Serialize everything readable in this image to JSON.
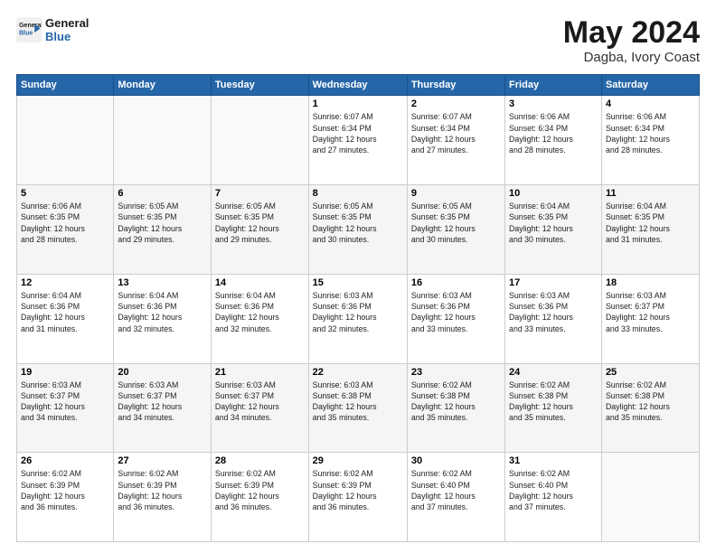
{
  "logo": {
    "line1": "General",
    "line2": "Blue"
  },
  "header": {
    "month_year": "May 2024",
    "location": "Dagba, Ivory Coast"
  },
  "weekdays": [
    "Sunday",
    "Monday",
    "Tuesday",
    "Wednesday",
    "Thursday",
    "Friday",
    "Saturday"
  ],
  "weeks": [
    [
      {
        "day": "",
        "info": ""
      },
      {
        "day": "",
        "info": ""
      },
      {
        "day": "",
        "info": ""
      },
      {
        "day": "1",
        "info": "Sunrise: 6:07 AM\nSunset: 6:34 PM\nDaylight: 12 hours\nand 27 minutes."
      },
      {
        "day": "2",
        "info": "Sunrise: 6:07 AM\nSunset: 6:34 PM\nDaylight: 12 hours\nand 27 minutes."
      },
      {
        "day": "3",
        "info": "Sunrise: 6:06 AM\nSunset: 6:34 PM\nDaylight: 12 hours\nand 28 minutes."
      },
      {
        "day": "4",
        "info": "Sunrise: 6:06 AM\nSunset: 6:34 PM\nDaylight: 12 hours\nand 28 minutes."
      }
    ],
    [
      {
        "day": "5",
        "info": "Sunrise: 6:06 AM\nSunset: 6:35 PM\nDaylight: 12 hours\nand 28 minutes."
      },
      {
        "day": "6",
        "info": "Sunrise: 6:05 AM\nSunset: 6:35 PM\nDaylight: 12 hours\nand 29 minutes."
      },
      {
        "day": "7",
        "info": "Sunrise: 6:05 AM\nSunset: 6:35 PM\nDaylight: 12 hours\nand 29 minutes."
      },
      {
        "day": "8",
        "info": "Sunrise: 6:05 AM\nSunset: 6:35 PM\nDaylight: 12 hours\nand 30 minutes."
      },
      {
        "day": "9",
        "info": "Sunrise: 6:05 AM\nSunset: 6:35 PM\nDaylight: 12 hours\nand 30 minutes."
      },
      {
        "day": "10",
        "info": "Sunrise: 6:04 AM\nSunset: 6:35 PM\nDaylight: 12 hours\nand 30 minutes."
      },
      {
        "day": "11",
        "info": "Sunrise: 6:04 AM\nSunset: 6:35 PM\nDaylight: 12 hours\nand 31 minutes."
      }
    ],
    [
      {
        "day": "12",
        "info": "Sunrise: 6:04 AM\nSunset: 6:36 PM\nDaylight: 12 hours\nand 31 minutes."
      },
      {
        "day": "13",
        "info": "Sunrise: 6:04 AM\nSunset: 6:36 PM\nDaylight: 12 hours\nand 32 minutes."
      },
      {
        "day": "14",
        "info": "Sunrise: 6:04 AM\nSunset: 6:36 PM\nDaylight: 12 hours\nand 32 minutes."
      },
      {
        "day": "15",
        "info": "Sunrise: 6:03 AM\nSunset: 6:36 PM\nDaylight: 12 hours\nand 32 minutes."
      },
      {
        "day": "16",
        "info": "Sunrise: 6:03 AM\nSunset: 6:36 PM\nDaylight: 12 hours\nand 33 minutes."
      },
      {
        "day": "17",
        "info": "Sunrise: 6:03 AM\nSunset: 6:36 PM\nDaylight: 12 hours\nand 33 minutes."
      },
      {
        "day": "18",
        "info": "Sunrise: 6:03 AM\nSunset: 6:37 PM\nDaylight: 12 hours\nand 33 minutes."
      }
    ],
    [
      {
        "day": "19",
        "info": "Sunrise: 6:03 AM\nSunset: 6:37 PM\nDaylight: 12 hours\nand 34 minutes."
      },
      {
        "day": "20",
        "info": "Sunrise: 6:03 AM\nSunset: 6:37 PM\nDaylight: 12 hours\nand 34 minutes."
      },
      {
        "day": "21",
        "info": "Sunrise: 6:03 AM\nSunset: 6:37 PM\nDaylight: 12 hours\nand 34 minutes."
      },
      {
        "day": "22",
        "info": "Sunrise: 6:03 AM\nSunset: 6:38 PM\nDaylight: 12 hours\nand 35 minutes."
      },
      {
        "day": "23",
        "info": "Sunrise: 6:02 AM\nSunset: 6:38 PM\nDaylight: 12 hours\nand 35 minutes."
      },
      {
        "day": "24",
        "info": "Sunrise: 6:02 AM\nSunset: 6:38 PM\nDaylight: 12 hours\nand 35 minutes."
      },
      {
        "day": "25",
        "info": "Sunrise: 6:02 AM\nSunset: 6:38 PM\nDaylight: 12 hours\nand 35 minutes."
      }
    ],
    [
      {
        "day": "26",
        "info": "Sunrise: 6:02 AM\nSunset: 6:39 PM\nDaylight: 12 hours\nand 36 minutes."
      },
      {
        "day": "27",
        "info": "Sunrise: 6:02 AM\nSunset: 6:39 PM\nDaylight: 12 hours\nand 36 minutes."
      },
      {
        "day": "28",
        "info": "Sunrise: 6:02 AM\nSunset: 6:39 PM\nDaylight: 12 hours\nand 36 minutes."
      },
      {
        "day": "29",
        "info": "Sunrise: 6:02 AM\nSunset: 6:39 PM\nDaylight: 12 hours\nand 36 minutes."
      },
      {
        "day": "30",
        "info": "Sunrise: 6:02 AM\nSunset: 6:40 PM\nDaylight: 12 hours\nand 37 minutes."
      },
      {
        "day": "31",
        "info": "Sunrise: 6:02 AM\nSunset: 6:40 PM\nDaylight: 12 hours\nand 37 minutes."
      },
      {
        "day": "",
        "info": ""
      }
    ]
  ]
}
